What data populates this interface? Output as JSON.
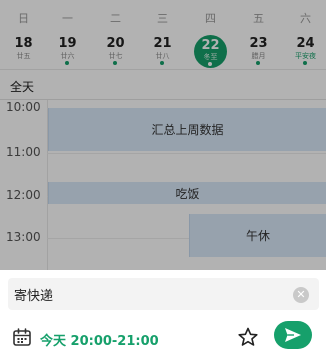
{
  "calendar": {
    "days": [
      {
        "dow": "日",
        "date": "18",
        "lunar": "廿五",
        "festival": false,
        "dot": false,
        "today": false
      },
      {
        "dow": "一",
        "date": "19",
        "lunar": "廿六",
        "festival": false,
        "dot": true,
        "today": false
      },
      {
        "dow": "二",
        "date": "20",
        "lunar": "廿七",
        "festival": false,
        "dot": true,
        "today": false
      },
      {
        "dow": "三",
        "date": "21",
        "lunar": "廿八",
        "festival": false,
        "dot": true,
        "today": false
      },
      {
        "dow": "四",
        "date": "22",
        "lunar": "冬至",
        "festival": false,
        "dot": true,
        "today": true
      },
      {
        "dow": "五",
        "date": "23",
        "lunar": "腊月",
        "festival": false,
        "dot": true,
        "today": false
      },
      {
        "dow": "六",
        "date": "24",
        "lunar": "平安夜",
        "festival": true,
        "dot": true,
        "today": false
      }
    ],
    "all_day_label": "全天",
    "hour_labels": [
      "10:00",
      "11:00",
      "12:00",
      "13:00"
    ],
    "events": [
      {
        "title": "汇总上周数据"
      },
      {
        "title": "吃饭"
      },
      {
        "title": "午休"
      }
    ]
  },
  "sheet": {
    "title_value": "寄快递",
    "clear_icon": "close-circle-icon",
    "calendar_icon": "calendar-icon",
    "time_text": "今天 20:00-21:00",
    "star_icon": "star-icon",
    "send_icon": "send-icon"
  },
  "colors": {
    "accent": "#16a06b",
    "event_bg": "#d8e8f8"
  }
}
